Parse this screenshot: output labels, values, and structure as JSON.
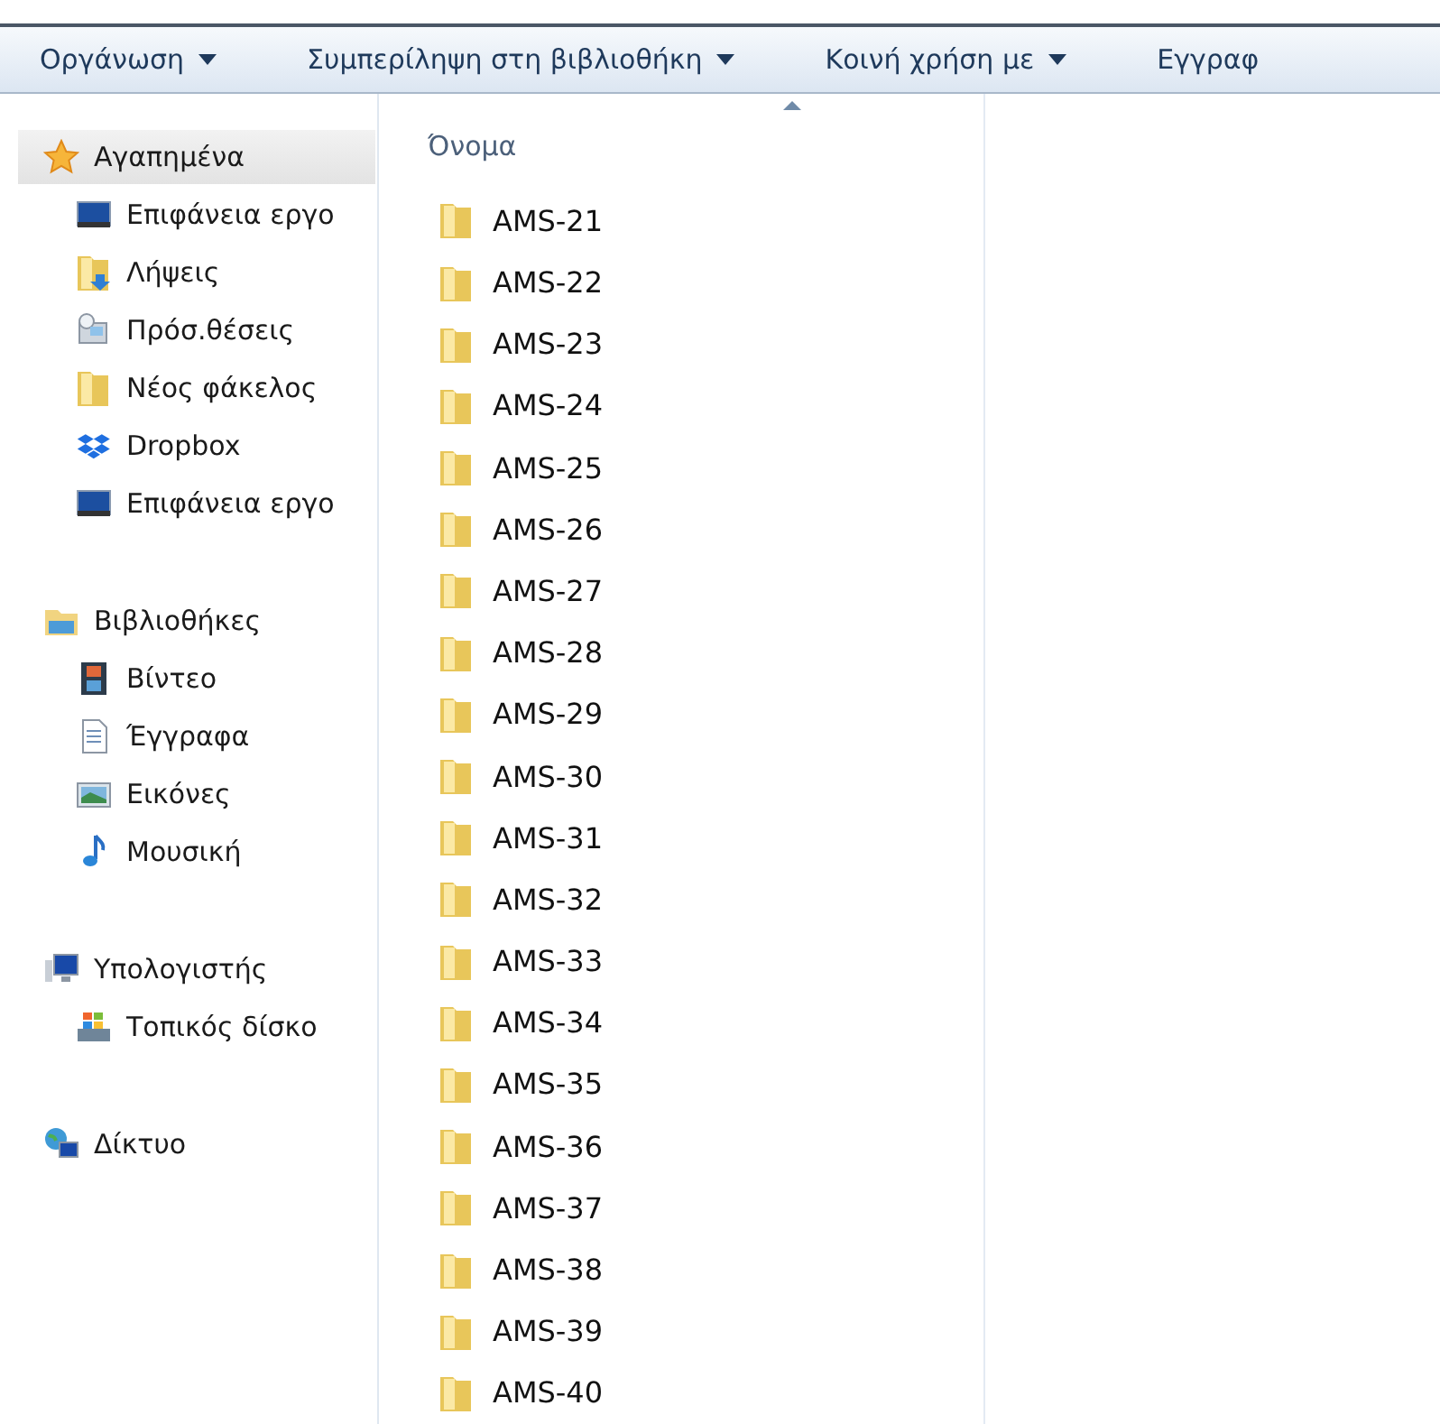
{
  "toolbar": [
    {
      "label": "Οργάνωση",
      "dropdown": true
    },
    {
      "label": "Συμπερίληψη στη βιβλιοθήκη",
      "dropdown": true
    },
    {
      "label": "Κοινή χρήση με",
      "dropdown": true
    },
    {
      "label": "Εγγραφ",
      "dropdown": false
    }
  ],
  "navigation": [
    {
      "label": "Αγαπημένα",
      "kind": "star",
      "selected": true,
      "children": [
        {
          "label": "Επιφάνεια εργο",
          "kind": "desktop",
          "selected": false
        },
        {
          "label": "Λήψεις",
          "kind": "downloads",
          "selected": false
        },
        {
          "label": "Πρόσ.θέσεις",
          "kind": "recent",
          "selected": false
        },
        {
          "label": "Νέος φάκελος",
          "kind": "folder",
          "selected": false
        },
        {
          "label": "Dropbox",
          "kind": "dropbox",
          "selected": false
        },
        {
          "label": "Επιφάνεια εργο",
          "kind": "desktop",
          "selected": false
        }
      ]
    },
    {
      "label": "Βιβλιοθήκες",
      "kind": "libraries",
      "selected": false,
      "children": [
        {
          "label": "Βίντεο",
          "kind": "video",
          "selected": false
        },
        {
          "label": "Έγγραφα",
          "kind": "documents",
          "selected": false
        },
        {
          "label": "Εικόνες",
          "kind": "pictures",
          "selected": false
        },
        {
          "label": "Μουσική",
          "kind": "music",
          "selected": false
        }
      ]
    },
    {
      "label": "Υπολογιστής",
      "kind": "computer",
      "selected": false,
      "children": [
        {
          "label": "Τοπικός δίσκο",
          "kind": "drive",
          "selected": false
        }
      ]
    },
    {
      "label": "Δίκτυο",
      "kind": "network",
      "selected": false
    }
  ],
  "file_list": {
    "column": "Όνομα",
    "sort_ascending": true,
    "items": [
      "AMS-21",
      "AMS-22",
      "AMS-23",
      "AMS-24",
      "AMS-25",
      "AMS-26",
      "AMS-27",
      "AMS-28",
      "AMS-29",
      "AMS-30",
      "AMS-31",
      "AMS-32",
      "AMS-33",
      "AMS-34",
      "AMS-35",
      "AMS-36",
      "AMS-37",
      "AMS-38",
      "AMS-39",
      "AMS-40"
    ]
  }
}
